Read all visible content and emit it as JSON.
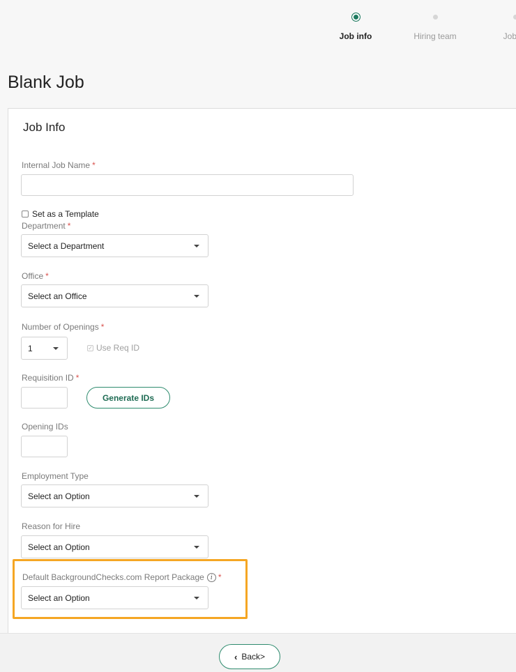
{
  "stepper": {
    "steps": [
      {
        "label": "Job info",
        "active": true
      },
      {
        "label": "Hiring team",
        "active": false
      },
      {
        "label": "Job kit",
        "active": false
      }
    ]
  },
  "page_title": "Blank Job",
  "card": {
    "title": "Job Info",
    "internal_job_name": {
      "label": "Internal Job Name",
      "value": ""
    },
    "set_as_template": {
      "label": "Set as a Template",
      "checked": false
    },
    "department": {
      "label": "Department",
      "value": "Select a Department"
    },
    "office": {
      "label": "Office",
      "value": "Select an Office"
    },
    "number_of_openings": {
      "label": "Number of Openings",
      "value": "1"
    },
    "use_req_id": {
      "label": "Use Req ID",
      "checked": true,
      "disabled": true
    },
    "requisition_id": {
      "label": "Requisition ID",
      "value": ""
    },
    "generate_ids_button": "Generate IDs",
    "opening_ids": {
      "label": "Opening IDs",
      "value": ""
    },
    "employment_type": {
      "label": "Employment Type",
      "value": "Select an Option"
    },
    "reason_for_hire": {
      "label": "Reason for Hire",
      "value": "Select an Option"
    },
    "background_check_package": {
      "label": "Default BackgroundChecks.com Report Package",
      "value": "Select an Option"
    },
    "required_marker": "*"
  },
  "footer": {
    "back_button": "Back>"
  },
  "colors": {
    "accent": "#2e8b6e",
    "highlight": "#f5a623",
    "required": "#d9534f"
  }
}
